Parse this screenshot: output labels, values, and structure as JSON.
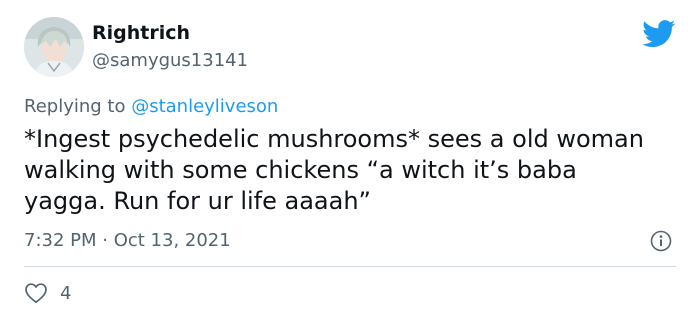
{
  "tweet": {
    "display_name": "Rightrich",
    "handle": "@samygus13141",
    "reply_prefix": "Replying to ",
    "reply_to": "@stanleyliveson",
    "text": "*Ingest psychedelic mushrooms* sees a old woman walking with some chickens “a witch it’s baba yagga. Run for ur life aaaah”",
    "timestamp": "7:32 PM · Oct 13, 2021",
    "like_count": "4"
  },
  "icons": {
    "brand": "twitter-bird-icon",
    "info": "info-icon",
    "like": "heart-icon"
  },
  "colors": {
    "brand": "#1d9bf0",
    "text": "#0f1419",
    "secondary": "#536471",
    "divider": "#cfd9de"
  }
}
